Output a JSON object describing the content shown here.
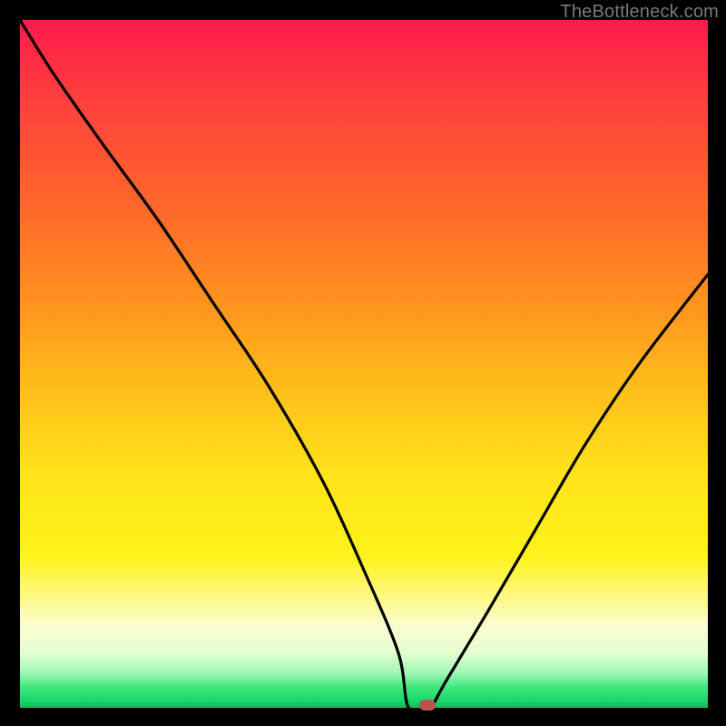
{
  "watermark": "TheBottleneck.com",
  "colors": {
    "frame": "#000000",
    "gradient_top": "#ff1a4d",
    "gradient_bottom": "#0fba5a",
    "curve": "#000000",
    "marker": "#b8564e"
  },
  "chart_data": {
    "type": "line",
    "title": "",
    "xlabel": "",
    "ylabel": "",
    "xlim": [
      0,
      100
    ],
    "ylim": [
      0,
      100
    ],
    "grid": false,
    "legend": false,
    "series": [
      {
        "name": "bottleneck-curve",
        "x": [
          0,
          5,
          12,
          20,
          28,
          36,
          44,
          50,
          55,
          56.5,
          59.5,
          62,
          68,
          75,
          82,
          90,
          100
        ],
        "values": [
          100,
          92,
          82,
          71,
          59,
          47,
          33,
          20,
          8,
          0,
          0,
          4,
          14,
          26,
          38,
          50,
          63
        ]
      }
    ],
    "marker": {
      "x": 59.2,
      "y": 0.4
    },
    "notes": "V-shaped curve with minimum (flat segment) near x≈56–60 at y≈0; left arm reaches y=100 at x=0; right arm rises to y≈63 at x=100."
  }
}
